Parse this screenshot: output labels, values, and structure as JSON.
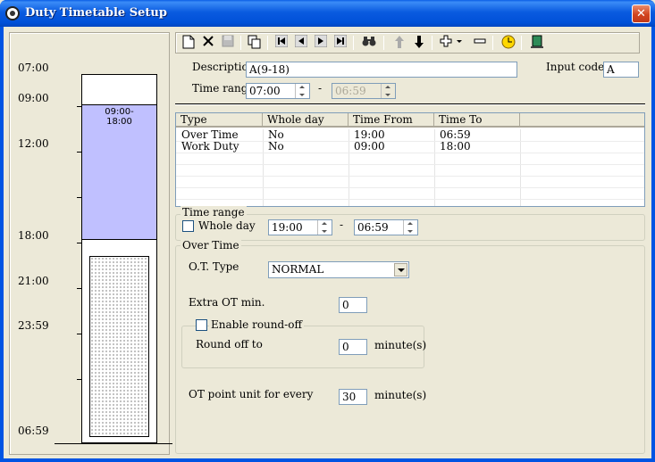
{
  "window": {
    "title": "Duty Timetable Setup",
    "close_glyph": "✕"
  },
  "timeline": {
    "labels": [
      "07:00",
      "09:00",
      "12:00",
      "18:00",
      "21:00",
      "23:59",
      "06:59"
    ],
    "segment_label": "09:00-\n18:00",
    "work_duty_color": "#c0c0ff"
  },
  "toolbar": {
    "icons": [
      "new-icon",
      "delete-icon",
      "save-icon",
      "copy-icon",
      "first-icon",
      "previous-icon",
      "next-icon",
      "last-icon",
      "find-icon",
      "move-up-icon",
      "move-down-icon",
      "add-icon",
      "remove-icon",
      "clock-icon",
      "exit-icon"
    ]
  },
  "form": {
    "description_label": "Description",
    "description_value": "A(9-18)",
    "input_code_label": "Input code :",
    "input_code_value": "A",
    "time_range_label": "Time range",
    "time_from": "07:00",
    "time_to": "06:59",
    "dash": "-"
  },
  "table": {
    "columns": [
      "Type",
      "Whole day",
      "Time From",
      "Time To"
    ],
    "rows": [
      [
        "Over Time",
        "No",
        "19:00",
        "06:59"
      ],
      [
        "Work Duty",
        "No",
        "09:00",
        "18:00"
      ]
    ]
  },
  "time_range_group": {
    "title": "Time range",
    "whole_day_label": "Whole day",
    "from": "19:00",
    "to": "06:59",
    "dash": "-"
  },
  "overtime_group": {
    "title": "Over Time",
    "ot_type_label": "O.T. Type",
    "ot_type_value": "NORMAL",
    "extra_ot_label": "Extra OT min.",
    "extra_ot_value": "0",
    "round_off_title": "Enable round-off",
    "round_off_label": "Round off to",
    "round_off_value": "0",
    "round_off_unit": "minute(s)",
    "point_unit_label": "OT point unit for every",
    "point_unit_value": "30",
    "point_unit_unit": "minute(s)"
  }
}
